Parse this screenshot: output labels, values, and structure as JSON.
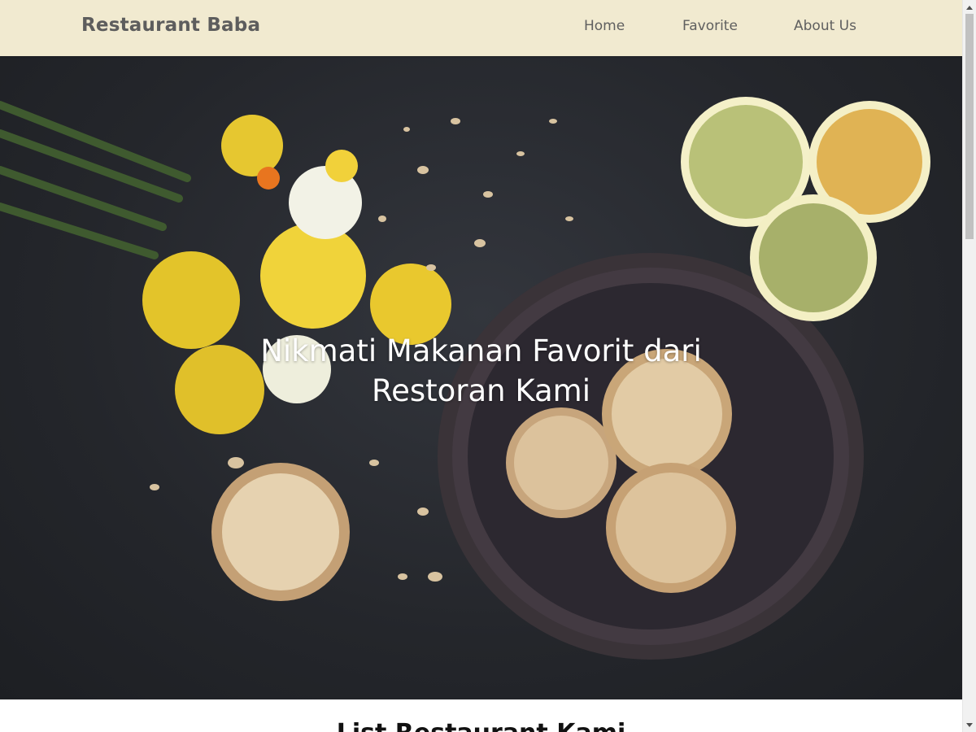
{
  "header": {
    "brand": "Restaurant Baba",
    "nav": [
      {
        "label": "Home"
      },
      {
        "label": "Favorite"
      },
      {
        "label": "About Us"
      }
    ]
  },
  "hero": {
    "title_line1": "Nikmati Makanan Favorit dari",
    "title_line2": "Restoran Kami"
  },
  "content": {
    "section_title": "List Restaurant Kami"
  },
  "colors": {
    "header_bg": "#f1ead0",
    "brand_text": "#5d5d5d",
    "hero_bg": "#26282d",
    "hero_text": "#ffffff"
  },
  "icons": [
    "scroll-up-arrow-icon",
    "scroll-down-arrow-icon"
  ]
}
